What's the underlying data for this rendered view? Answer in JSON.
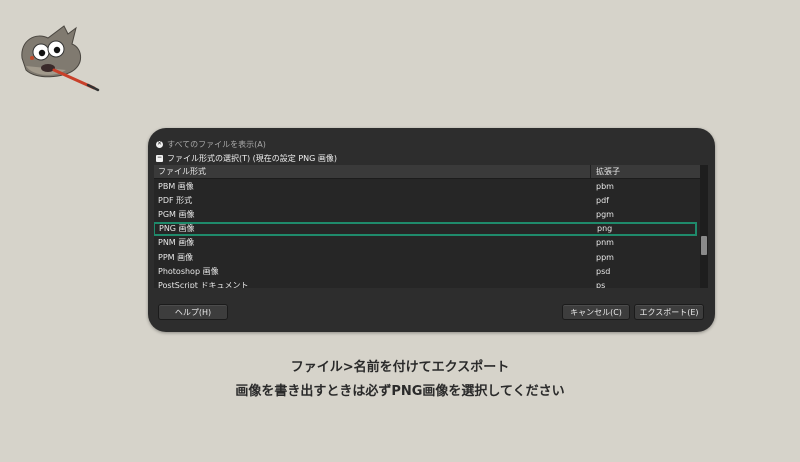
{
  "dialog": {
    "show_all_label": "すべてのファイルを表示(A)",
    "select_type_label": "ファイル形式の選択(T) (現在の設定 PNG 画像)",
    "columns": {
      "name": "ファイル形式",
      "ext": "拡張子"
    },
    "rows": [
      {
        "name": "PBM 画像",
        "ext": "pbm"
      },
      {
        "name": "PDF 形式",
        "ext": "pdf"
      },
      {
        "name": "PGM 画像",
        "ext": "pgm"
      },
      {
        "name": "PNG 画像",
        "ext": "png"
      },
      {
        "name": "PNM 画像",
        "ext": "pnm"
      },
      {
        "name": "PPM 画像",
        "ext": "ppm"
      },
      {
        "name": "Photoshop 画像",
        "ext": "psd"
      },
      {
        "name": "PostScript ドキュメント",
        "ext": "ps"
      }
    ],
    "selected_row": "PNG 画像",
    "help_button": "ヘルプ(H)",
    "cancel_button": "キャンセル(C)",
    "export_button": "エクスポート(E)"
  },
  "caption": {
    "line1": "ファイル>名前を付けてエクスポート",
    "line2": "画像を書き出すときは必ずPNG画像を選択してください"
  },
  "colors": {
    "page_background": "#d6d3ca",
    "dialog_background": "#2d2d2d",
    "selection_outline": "#1f8a6b"
  },
  "icons": {
    "logo": "gimp-wilber-logo",
    "show_all_check": "x-circle-icon",
    "select_type_check": "minus-box-icon"
  }
}
